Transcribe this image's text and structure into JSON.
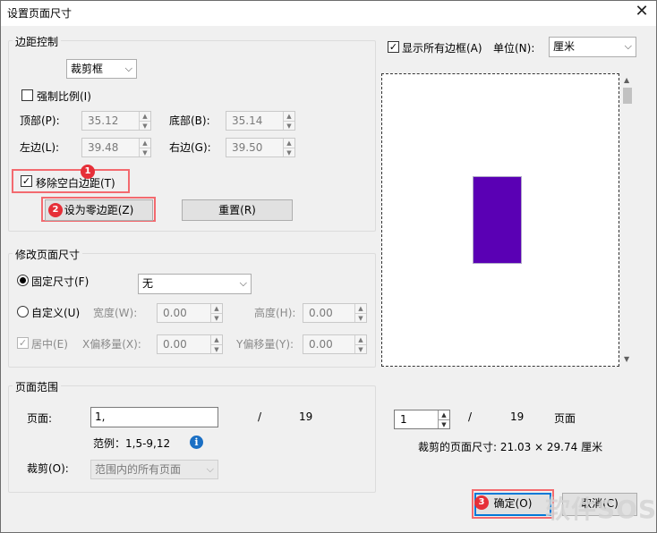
{
  "window": {
    "title": "设置页面尺寸",
    "close": "✕"
  },
  "margins": {
    "group_label": "边距控制",
    "box_mode": "裁剪框",
    "force_ratio": "强制比例(I)",
    "top_label": "顶部(P):",
    "top_value": "35.12",
    "bottom_label": "底部(B):",
    "bottom_value": "35.14",
    "left_label": "左边(L):",
    "left_value": "39.48",
    "right_label": "右边(G):",
    "right_value": "39.50",
    "remove_white": "移除空白边距(T)",
    "remove_white_checked": true,
    "set_zero": "设为零边距(Z)",
    "reset": "重置(R)"
  },
  "page_size": {
    "group_label": "修改页面尺寸",
    "fixed_label": "固定尺寸(F)",
    "fixed_value": "无",
    "custom_label": "自定义(U)",
    "width_label": "宽度(W):",
    "width_value": "0.00",
    "height_label": "高度(H):",
    "height_value": "0.00",
    "center_label": "居中(E)",
    "xoffset_label": "X偏移量(X):",
    "xoffset_value": "0.00",
    "yoffset_label": "Y偏移量(Y):",
    "yoffset_value": "0.00"
  },
  "page_range": {
    "group_label": "页面范围",
    "pages_label": "页面:",
    "pages_value": "1,",
    "slash": "/",
    "total": "19",
    "example": "范例：1,5-9,12",
    "crop_label": "裁剪(O):",
    "crop_value": "范围内的所有页面"
  },
  "preview": {
    "show_all_boxes": "显示所有边框(A)",
    "unit_label": "单位(N):",
    "unit_value": "厘米",
    "page_current": "1",
    "slash": "/",
    "page_total": "19",
    "page_word": "页面",
    "crop_size": "裁剪的页面尺寸: 21.03 × 29.74  厘米",
    "page_color": "#5a00b4"
  },
  "buttons": {
    "ok": "确定(O)",
    "cancel": "取消(C)"
  },
  "markers": {
    "m1": "1",
    "m2": "2",
    "m3": "3"
  },
  "watermark": "软件SOS",
  "icons": {
    "info": "i",
    "check": "✓",
    "chevron": "⌵"
  }
}
